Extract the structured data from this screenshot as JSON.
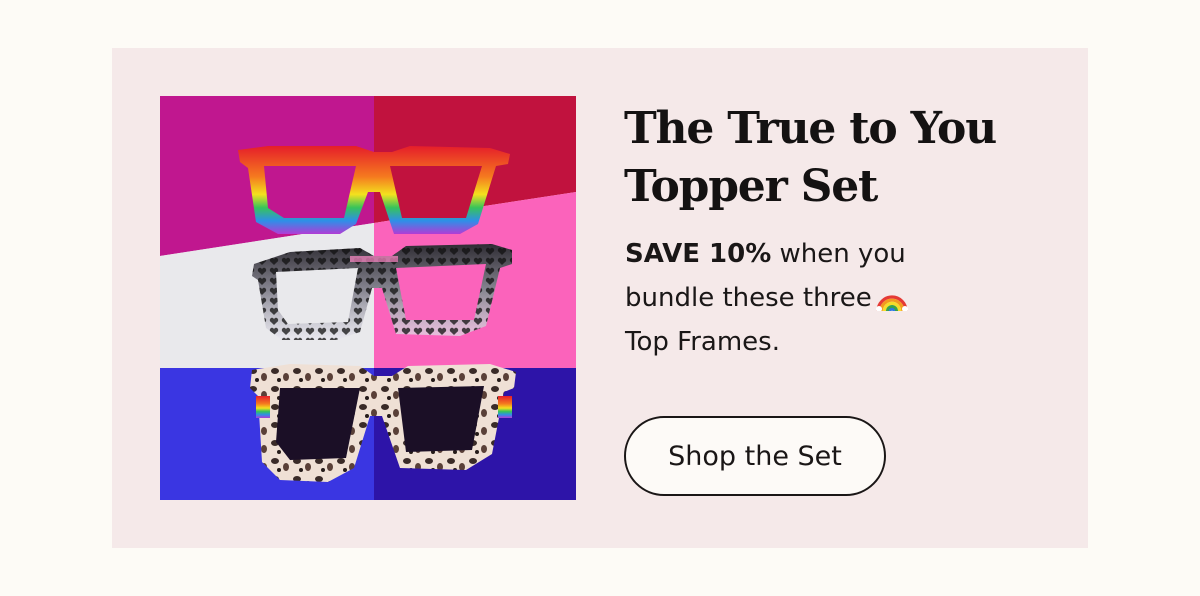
{
  "promo": {
    "title_line1": "The True to You",
    "title_line2": "Topper Set",
    "save_text": "SAVE 10%",
    "body_text_1": " when you bundle these three",
    "emoji": "rainbow-emoji",
    "body_text_2": "Top Frames.",
    "button_label": "Shop the Set"
  },
  "image": {
    "description_name": "three-rainbow-top-frames"
  },
  "colors": {
    "page_background": "#fdfbf6",
    "card_background": "#f5e9e9",
    "text": "#141212",
    "button_border": "#1a1616"
  }
}
